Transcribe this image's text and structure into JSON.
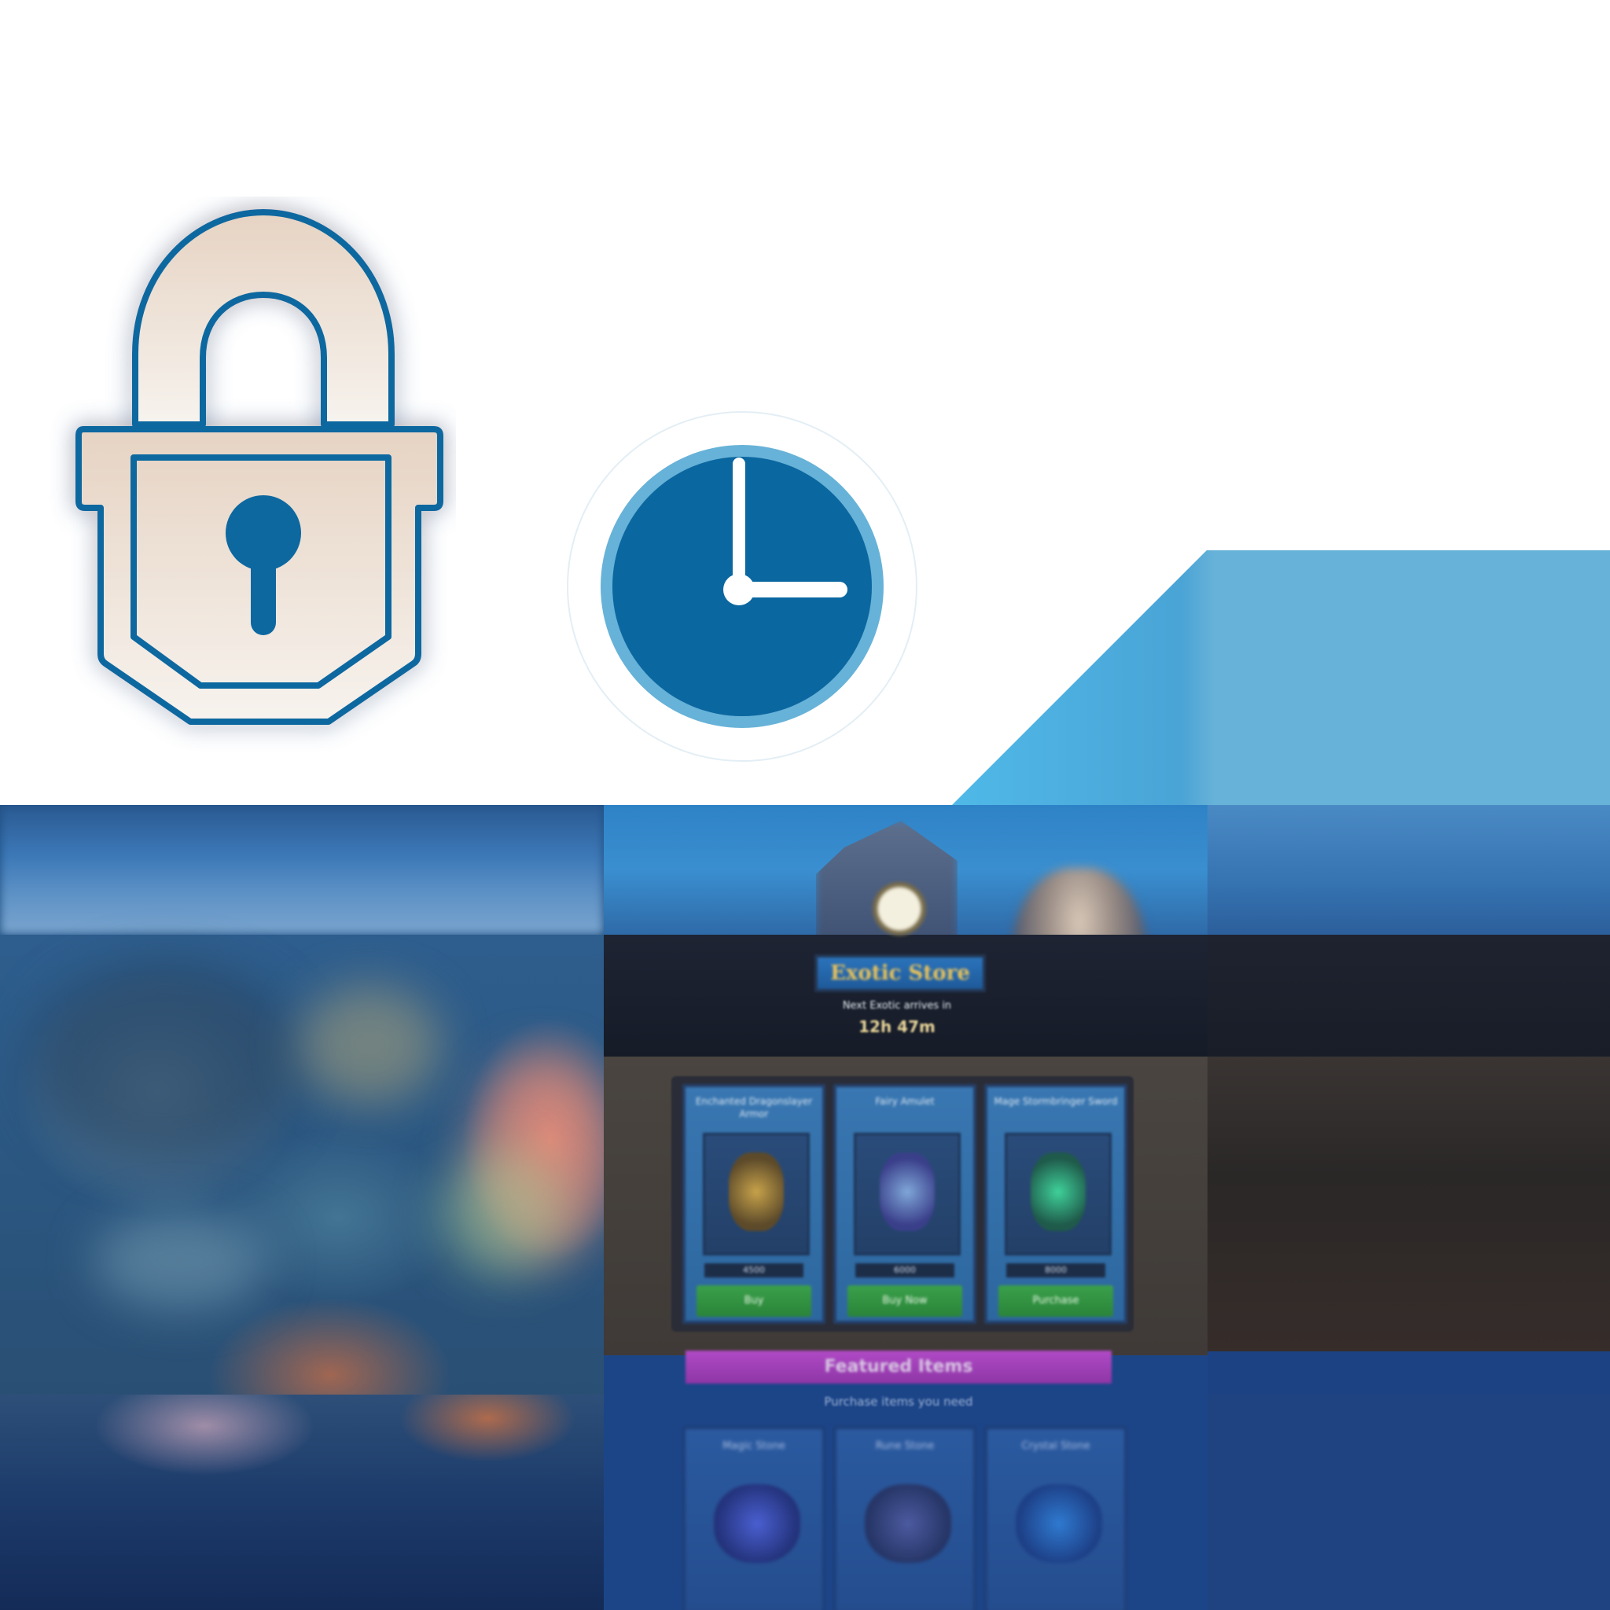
{
  "atlas": {
    "icons": {
      "lock": "lock-icon",
      "clock": "clock-icon",
      "clock_time": "3:00"
    },
    "colors": {
      "icon_blue": "#0b67a0",
      "lock_fill_top": "#e6d3c3",
      "lock_fill_bottom": "#f7f3ee",
      "glow": "#56c6ff",
      "clock_ring": "#67b2d8",
      "banner_blue": "#67b2d8",
      "shop_button_green": "#34a046",
      "purple_banner": "#a83fbf"
    }
  },
  "shop_preview": {
    "banner_title": "Exotic Store",
    "banner_subtitle": "Next Exotic arrives in",
    "timer": "12h 47m",
    "cards": [
      {
        "title": "Enchanted Dragonslayer Armor",
        "price": "4500",
        "button": "Buy",
        "item_color": "#c7a24a"
      },
      {
        "title": "Fairy Amulet",
        "price": "6000",
        "button": "Buy Now",
        "item_color": "#7fa6d8"
      },
      {
        "title": "Mage Stormbringer Sword",
        "price": "8000",
        "button": "Purchase",
        "item_color": "#3fd19a"
      }
    ],
    "featured_banner": "Featured Items",
    "featured_caption": "Purchase items you need",
    "lower_cards": [
      {
        "title": "Magic Stone",
        "art_color": "#4a5fd0"
      },
      {
        "title": "Rune Stone",
        "art_color": "#4c5aa0"
      },
      {
        "title": "Crystal Stone",
        "art_color": "#2f7ad0"
      }
    ]
  }
}
